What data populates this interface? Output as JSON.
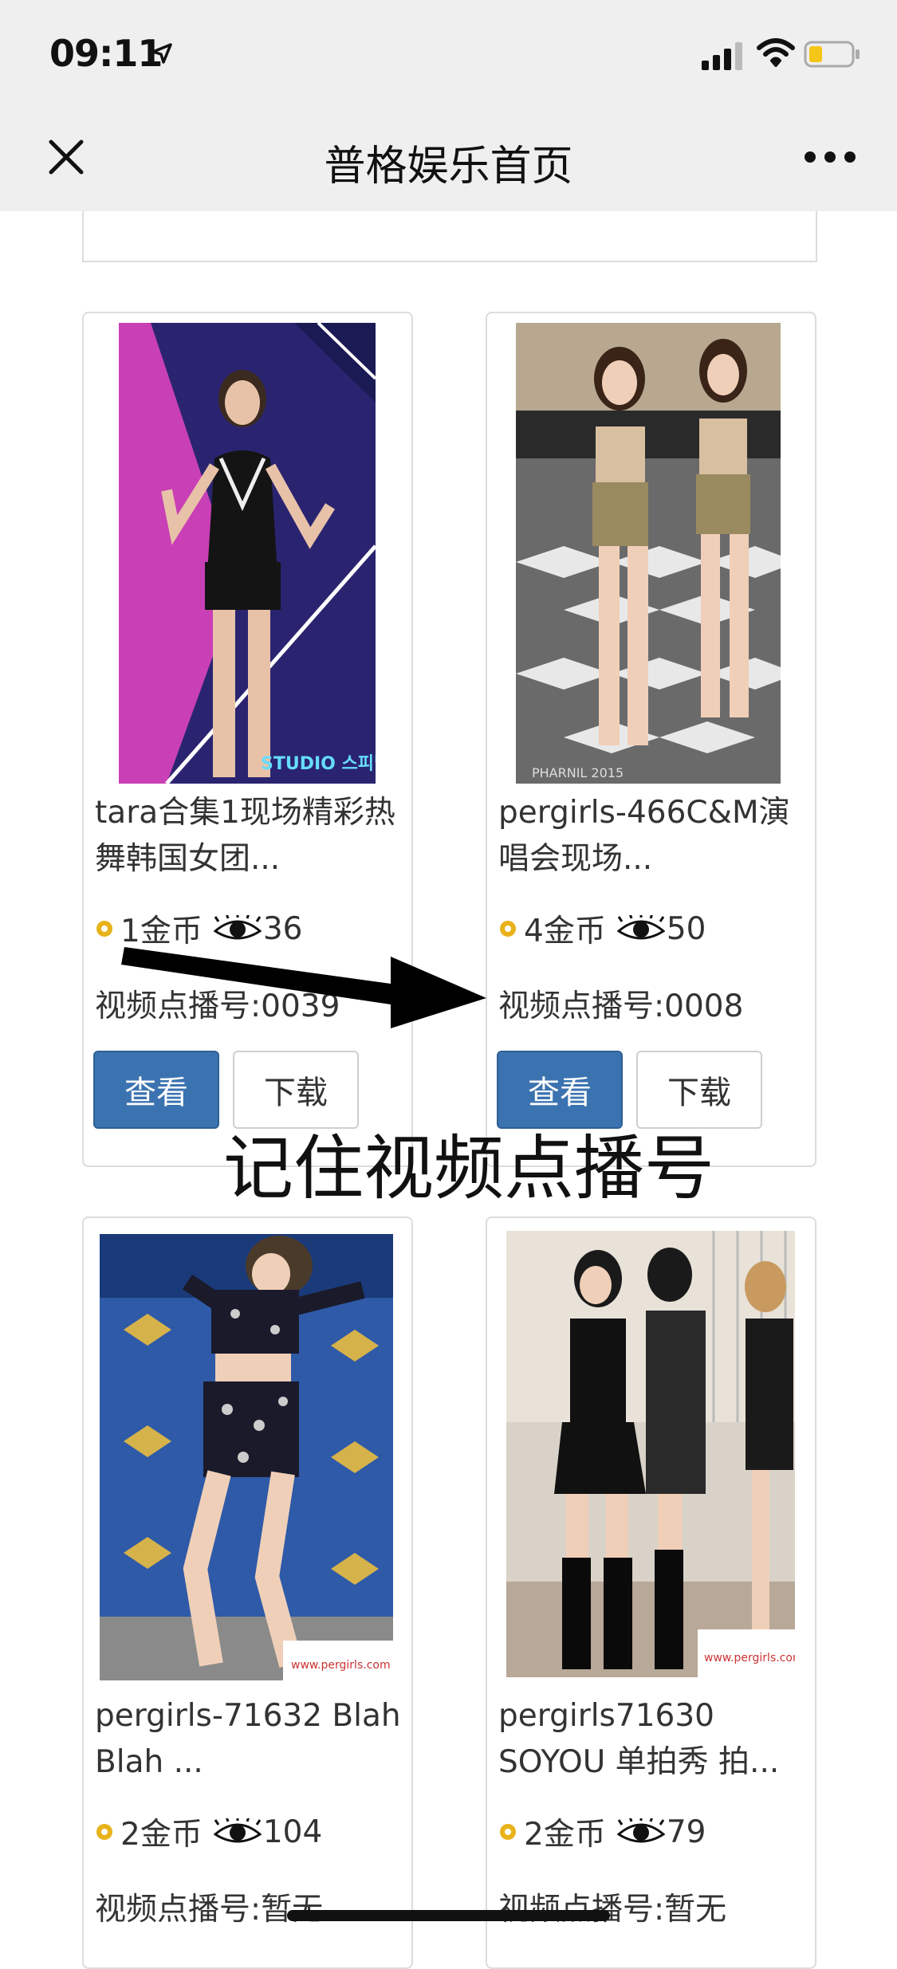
{
  "status": {
    "time": "09:11"
  },
  "header": {
    "title": "普格娱乐首页"
  },
  "cards": [
    {
      "title": "tara合集1现场精彩热舞韩国女团...",
      "coins": "1金币",
      "views": "36",
      "vid": "视频点播号:0039",
      "view_btn": "查看",
      "download_btn": "下载",
      "watermark": "STUDIO 스피넬"
    },
    {
      "title": "pergirls-466C&M演唱会现场...",
      "coins": "4金币",
      "views": "50",
      "vid": "视频点播号:0008",
      "view_btn": "查看",
      "download_btn": "下载",
      "watermark": "PHARNIL 2015"
    },
    {
      "title": "pergirls-71632 Blah Blah ...",
      "coins": "2金币",
      "views": "104",
      "vid": "视频点播号:暂无",
      "watermark": "www.pergirls.com"
    },
    {
      "title": "pergirls71630 SOYOU 单拍秀 拍...",
      "coins": "2金币",
      "views": "79",
      "vid": "视频点播号:暂无",
      "watermark": "www.pergirls.com"
    }
  ],
  "overlay": {
    "text": "记住视频点播号"
  },
  "colors": {
    "accent": "#3b73b0",
    "coin": "#e8b21a"
  }
}
